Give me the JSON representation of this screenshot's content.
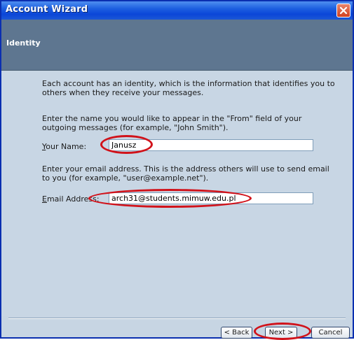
{
  "window": {
    "title": "Account Wizard",
    "close_icon": "close-icon",
    "header_title": "Identity"
  },
  "intro_text": "Each account has an identity, which is the information that identifies you to others when they receive your messages.",
  "name_section": {
    "instruction": "Enter the name you would like to appear in the \"From\" field of your outgoing messages (for example, \"John Smith\").",
    "label_accesskey": "Y",
    "label_rest": "our Name:",
    "value": "Janusz"
  },
  "email_section": {
    "instruction": "Enter your email address. This is the address others will use to send email to you (for example, \"user@example.net\").",
    "label_accesskey": "E",
    "label_rest": "mail Address:",
    "value": "arch31@students.mimuw.edu.pl"
  },
  "buttons": {
    "back": "< Back",
    "next": "Next >",
    "cancel": "Cancel"
  },
  "colors": {
    "highlight_ellipse": "#d1121a",
    "titlebar": "#1d5fe0",
    "header_band": "#5e7690",
    "content_bg": "#c8d6e4"
  }
}
